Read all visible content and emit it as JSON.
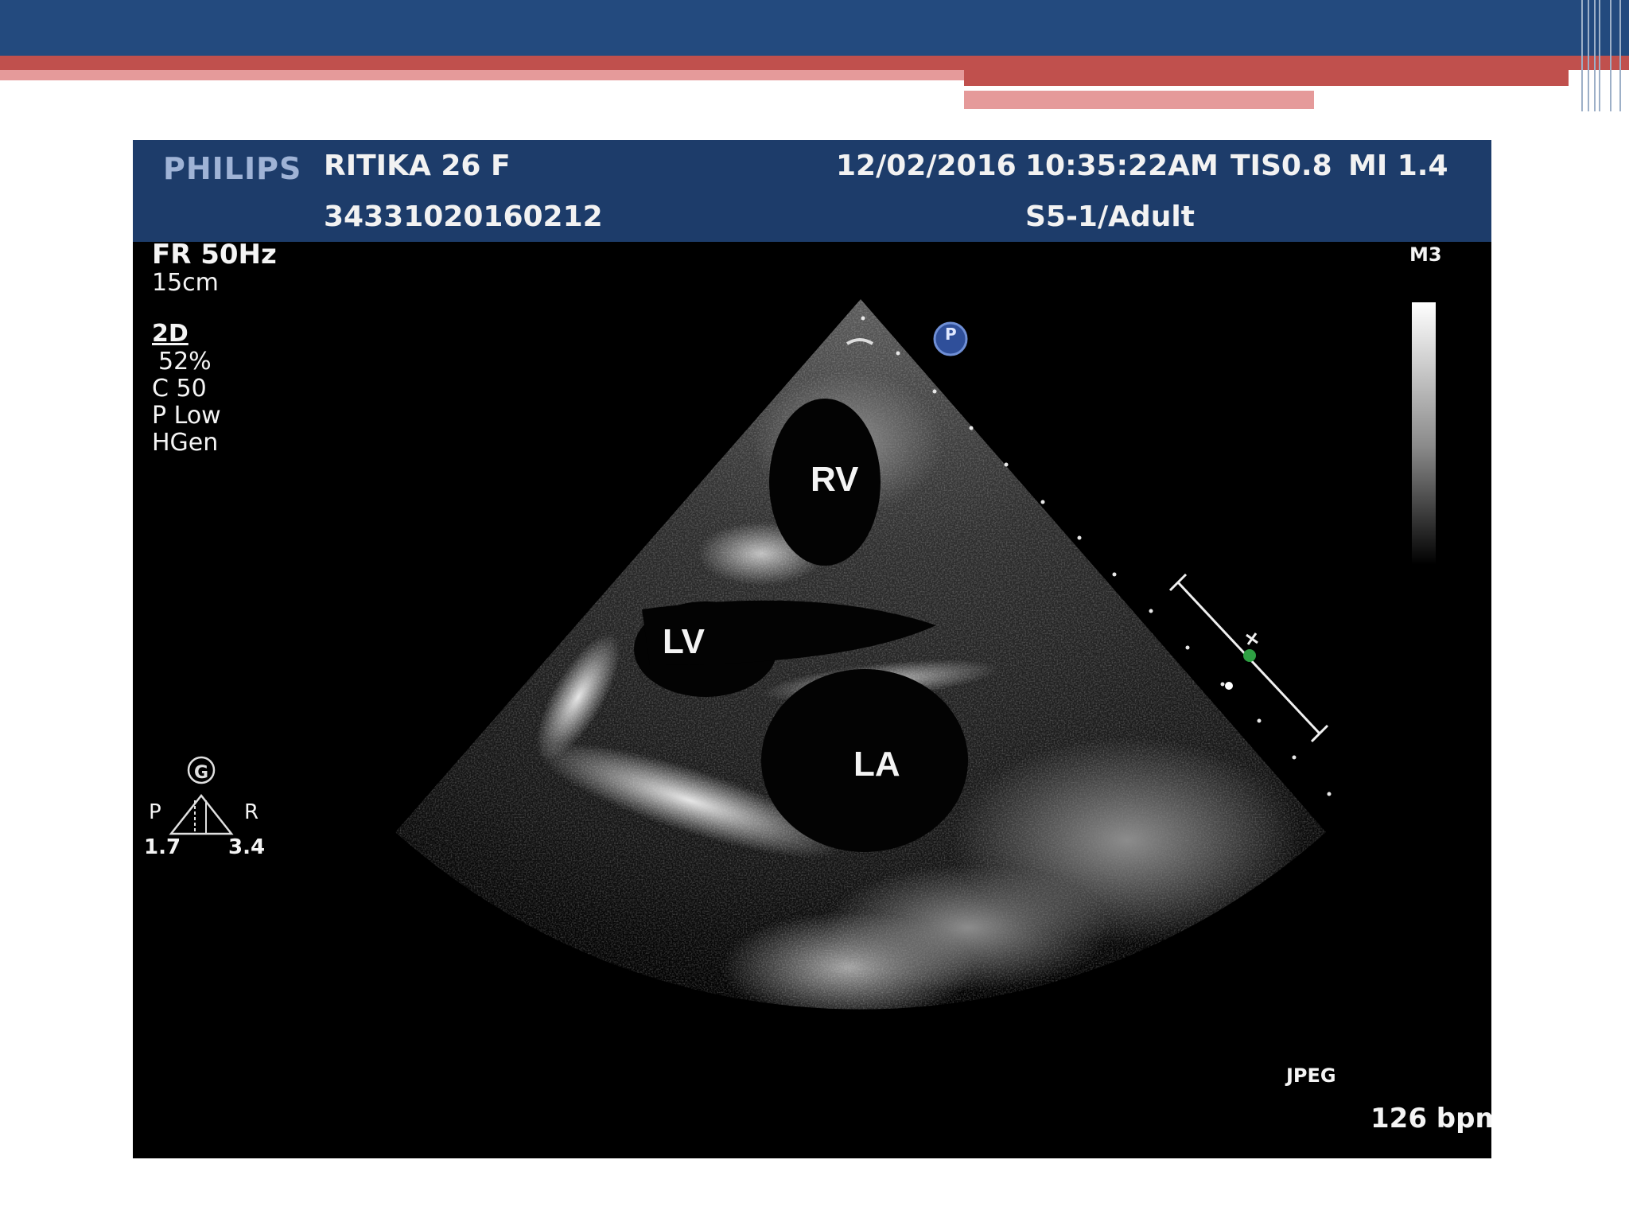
{
  "header": {
    "brand": "PHILIPS",
    "patient": "RITIKA 26 F",
    "patient_id": "34331020160212",
    "date": "12/02/2016",
    "time": "10:35:22AM",
    "tis": "TIS0.8",
    "mi": "MI 1.4",
    "probe_preset": "S5-1/Adult"
  },
  "settings": {
    "frame_rate": "FR 50Hz",
    "depth": "15cm",
    "mode": "2D",
    "gain": "52%",
    "compression": "C 50",
    "power": "P Low",
    "harmonic": "HGen"
  },
  "labels": {
    "rv": "RV",
    "lv": "LV",
    "la": "LA",
    "map": "M3",
    "format": "JPEG",
    "heart_rate": "126 bpm",
    "probe_marker": "P"
  },
  "orientation": {
    "gyro": "G",
    "left": "P",
    "right": "R",
    "left_value": "1.7",
    "right_value": "3.4"
  },
  "colors": {
    "slide_band": "#234a7e",
    "slide_stripe": "#c0504d",
    "header_bg": "#1d3c6a",
    "marker_dot": "#2ea043"
  }
}
